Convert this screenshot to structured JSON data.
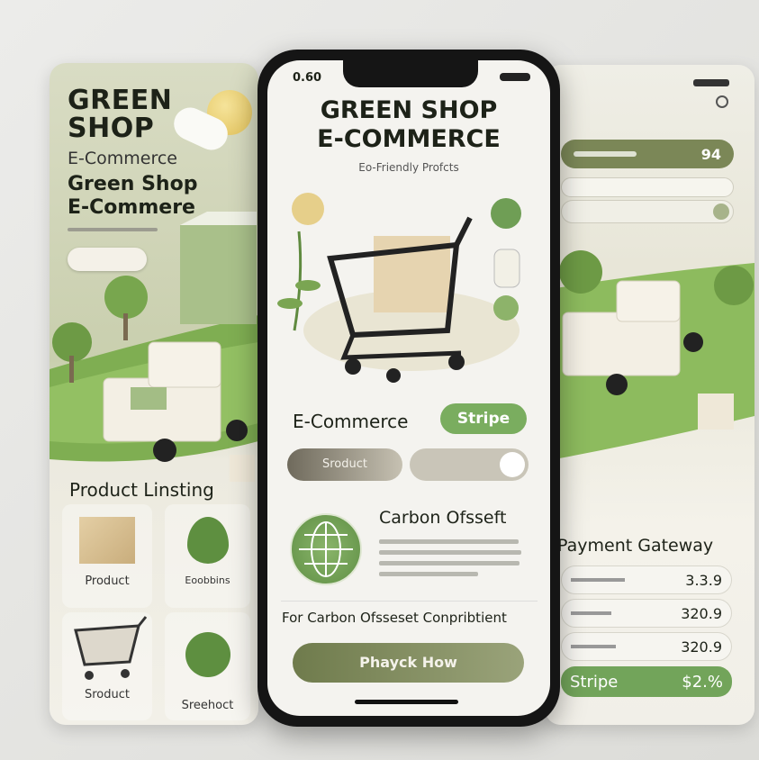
{
  "left_panel": {
    "brand_line1": "GREEN",
    "brand_line2": "SHOP",
    "brand_sub": "E-Commerce",
    "title_line1": "Green Shop",
    "title_line2": "E-Commere",
    "section_title": "Product Linsting",
    "tiles": [
      {
        "label": "Product",
        "icon": "box-icon"
      },
      {
        "label": "Eoobbins",
        "icon": "leaf-icon"
      },
      {
        "label": "Sroduct",
        "icon": "cart-icon"
      },
      {
        "label": "Sreehoct",
        "icon": "sprout-icon"
      }
    ]
  },
  "phone": {
    "status_time": "0.60",
    "title_line1": "GREEN SHOP",
    "title_line2": "E-COMMERCE",
    "subtitle": "Eo-Friendly Profcts",
    "ecommerce_label": "E-Commerce",
    "stripe_badge": "Stripe",
    "product_pill": "Sroduct",
    "carbon_title": "Carbon Ofsseft",
    "contribution_label": "For Carbon Ofsseset Conpribtient",
    "cta_button": "Phayck How",
    "colors": {
      "accent_green": "#7aad5f",
      "olive": "#7b8757",
      "bezel": "#151515"
    }
  },
  "right_panel": {
    "top_value": "94",
    "section_title": "Payment Gateway",
    "rows": [
      {
        "amount": "3.3.9"
      },
      {
        "amount": "320.9"
      },
      {
        "amount": "320.9"
      }
    ],
    "stripe_row": {
      "label": "Stripe",
      "value": "$2.%"
    }
  }
}
